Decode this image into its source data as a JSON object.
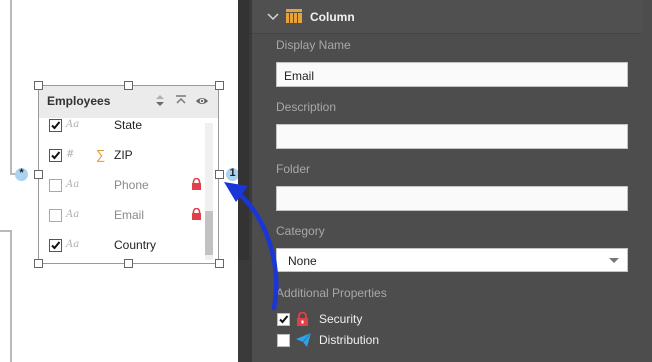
{
  "canvas": {
    "table": {
      "title": "Employees",
      "fields": [
        {
          "name": "State",
          "type_symbol": "Aa",
          "checked": true,
          "measure": false,
          "secured": false,
          "hidden": false
        },
        {
          "name": "ZIP",
          "type_symbol": "#",
          "checked": true,
          "measure": true,
          "secured": false,
          "hidden": false
        },
        {
          "name": "Phone",
          "type_symbol": "Aa",
          "checked": false,
          "measure": false,
          "secured": true,
          "hidden": true
        },
        {
          "name": "Email",
          "type_symbol": "Aa",
          "checked": false,
          "measure": false,
          "secured": true,
          "hidden": true
        },
        {
          "name": "Country",
          "type_symbol": "Aa",
          "checked": true,
          "measure": false,
          "secured": false,
          "hidden": false
        }
      ],
      "measure_symbol": "∑",
      "left_connector": "*",
      "right_connector": "1"
    }
  },
  "panel": {
    "section_title": "Column",
    "display_name": {
      "label": "Display Name",
      "value": "Email"
    },
    "description": {
      "label": "Description",
      "value": ""
    },
    "folder": {
      "label": "Folder",
      "value": ""
    },
    "category": {
      "label": "Category",
      "value": "None"
    },
    "additional": {
      "label": "Additional Properties",
      "items": [
        {
          "label": "Security",
          "checked": true,
          "icon": "lock-icon"
        },
        {
          "label": "Distribution",
          "checked": false,
          "icon": "send-icon"
        }
      ]
    }
  },
  "colors": {
    "panel_bg": "#4d4d4d",
    "lock": "#e0404a",
    "measure": "#e39a2e",
    "connector": "#a9d3f0",
    "annotation_arrow": "#1a35d8",
    "distribution": "#2fa3e6"
  }
}
